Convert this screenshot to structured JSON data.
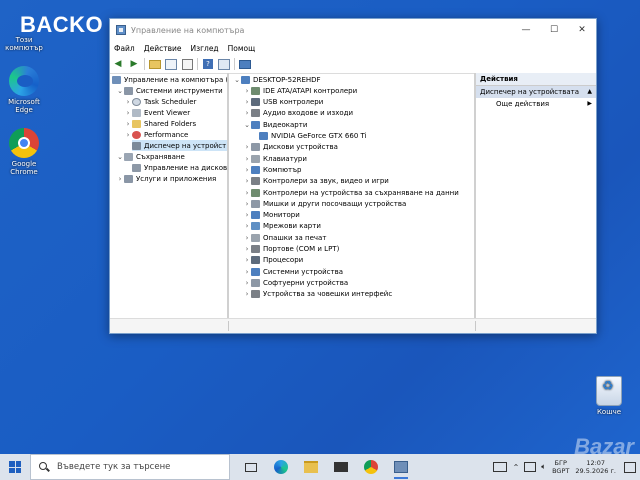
{
  "desktop": {
    "wordmark": "BACKO",
    "icons": [
      {
        "label_line1": "Този",
        "label_line2": "компютър"
      },
      {
        "label_line1": "Microsoft",
        "label_line2": "Edge"
      },
      {
        "label_line1": "Google",
        "label_line2": "Chrome"
      },
      {
        "label_line1": "Кошче",
        "label_line2": ""
      }
    ],
    "watermark": "Bazar"
  },
  "window": {
    "title": "Управление на компютъра",
    "buttons": {
      "minimize": "—",
      "maximize": "☐",
      "close": "✕"
    },
    "menu": [
      "Файл",
      "Действие",
      "Изглед",
      "Помощ"
    ]
  },
  "tree": {
    "root": "Управление на компютъра (л",
    "items": [
      {
        "label": "Системни инструменти",
        "level": 1,
        "expanded": true
      },
      {
        "label": "Task Scheduler",
        "level": 2
      },
      {
        "label": "Event Viewer",
        "level": 2
      },
      {
        "label": "Shared Folders",
        "level": 2
      },
      {
        "label": "Performance",
        "level": 2
      },
      {
        "label": "Диспечер на устройст",
        "level": 2,
        "selected": true
      },
      {
        "label": "Съхраняване",
        "level": 1,
        "expanded": true
      },
      {
        "label": "Управление на дисков",
        "level": 2
      },
      {
        "label": "Услуги и приложения",
        "level": 1
      }
    ]
  },
  "devices": {
    "computer": "DESKTOP-52REHDF",
    "categories": [
      "IDE ATA/ATAPI контролери",
      "USB контролери",
      "Аудио входове и изходи",
      "Видеокарти",
      "NVIDIA GeForce GTX 660 Ti",
      "Дискови устройства",
      "Клавиатури",
      "Компютър",
      "Контролери за звук, видео и игри",
      "Контролери на устройства за съхраняване на данни",
      "Мишки и други посочващи устройства",
      "Монитори",
      "Мрежови карти",
      "Опашки за печат",
      "Портове (COM и LPT)",
      "Процесори",
      "Системни устройства",
      "Софтуерни устройства",
      "Устройства за човешки интерфейс"
    ]
  },
  "actions": {
    "header": "Действия",
    "section": "Диспечер на устройствата",
    "more": "Още действия"
  },
  "taskbar": {
    "search_placeholder": "Въведете тук за търсене",
    "lang_line1": "БГР",
    "lang_line2": "BGPT",
    "time": "12:07",
    "date": "29.5.2026 г."
  }
}
